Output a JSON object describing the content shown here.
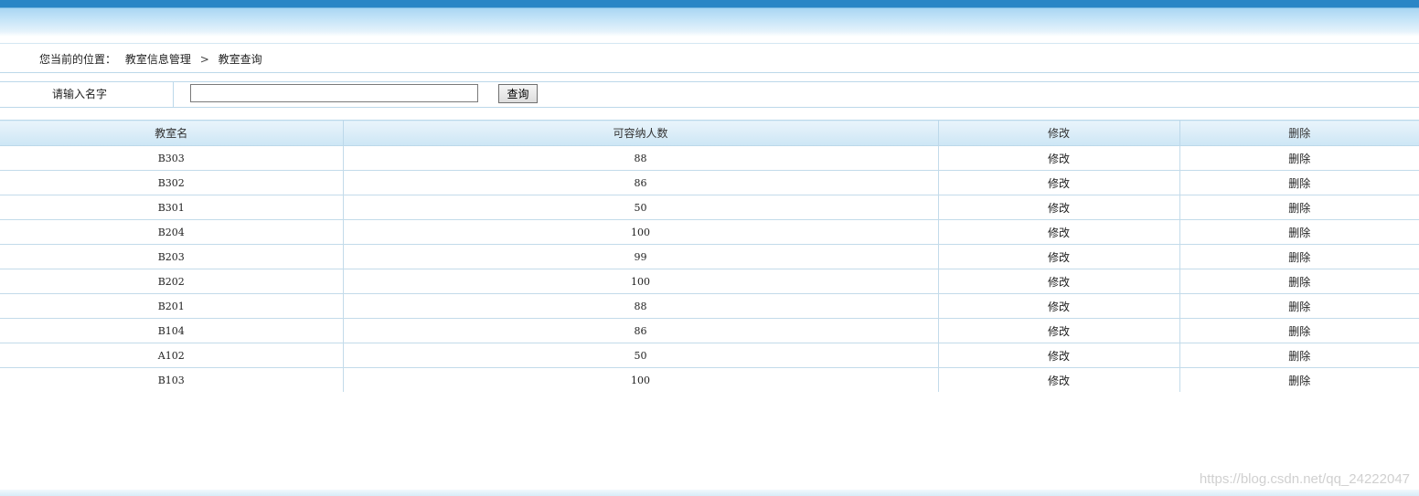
{
  "breadcrumb": {
    "label": "您当前的位置：",
    "section": "教室信息管理",
    "separator": ">",
    "current": "教室查询"
  },
  "search": {
    "label": "请输入名字",
    "value": "",
    "placeholder": "",
    "button_label": "查询"
  },
  "table": {
    "headers": [
      "教室名",
      "可容纳人数",
      "修改",
      "删除"
    ],
    "rows": [
      {
        "name": "B303",
        "capacity": "88",
        "edit": "修改",
        "delete": "删除"
      },
      {
        "name": "B302",
        "capacity": "86",
        "edit": "修改",
        "delete": "删除"
      },
      {
        "name": "B301",
        "capacity": "50",
        "edit": "修改",
        "delete": "删除"
      },
      {
        "name": "B204",
        "capacity": "100",
        "edit": "修改",
        "delete": "删除"
      },
      {
        "name": "B203",
        "capacity": "99",
        "edit": "修改",
        "delete": "删除"
      },
      {
        "name": "B202",
        "capacity": "100",
        "edit": "修改",
        "delete": "删除"
      },
      {
        "name": "B201",
        "capacity": "88",
        "edit": "修改",
        "delete": "删除"
      },
      {
        "name": "B104",
        "capacity": "86",
        "edit": "修改",
        "delete": "删除"
      },
      {
        "name": "A102",
        "capacity": "50",
        "edit": "修改",
        "delete": "删除"
      },
      {
        "name": "B103",
        "capacity": "100",
        "edit": "修改",
        "delete": "删除"
      }
    ]
  },
  "watermark": "https://blog.csdn.net/qq_24222047",
  "colors": {
    "header_bar": "#2a86c6",
    "border": "#bcd8ea",
    "table_header_bg": "#cde6f5"
  }
}
